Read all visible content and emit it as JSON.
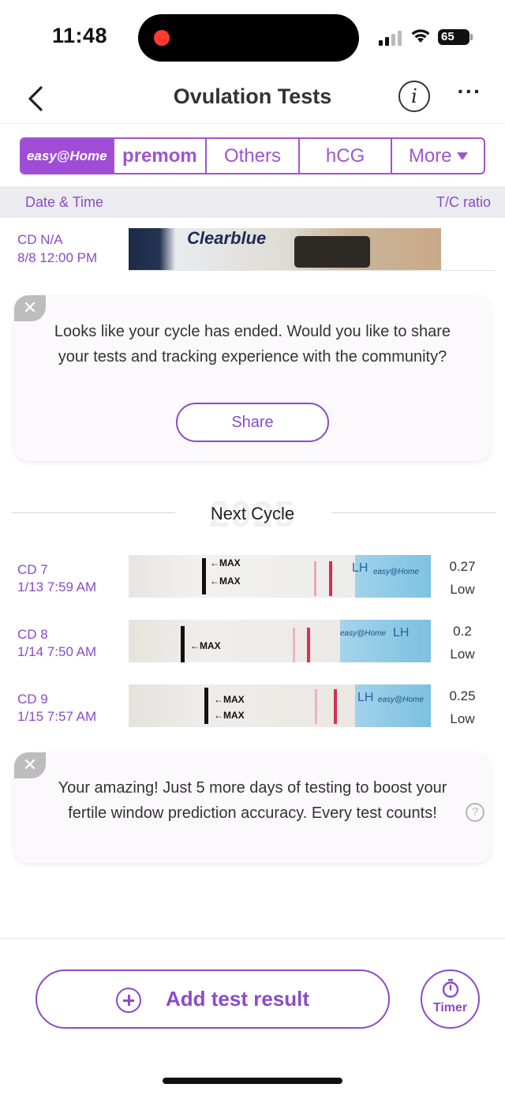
{
  "status_bar": {
    "time": "11:48",
    "battery": "65"
  },
  "nav": {
    "title": "Ovulation Tests"
  },
  "tabs": [
    {
      "label": "easy@Home"
    },
    {
      "label": "premom"
    },
    {
      "label": "Others"
    },
    {
      "label": "hCG"
    },
    {
      "label": "More"
    }
  ],
  "columns": {
    "left": "Date & Time",
    "right": "T/C ratio"
  },
  "previous_cycle_row": {
    "cd": "CD N/A",
    "datetime": "8/8 12:00 PM",
    "strip_brand": "Clearblue"
  },
  "share_card": {
    "text": "Looks like your cycle has ended. Would you like to share your tests and tracking experience with the community?",
    "button": "Share"
  },
  "divider": {
    "watermark": "2025",
    "label": "Next Cycle"
  },
  "tests": [
    {
      "cd": "CD 7",
      "datetime": "1/13 7:59 AM",
      "ratio": "0.27",
      "level": "Low"
    },
    {
      "cd": "CD 8",
      "datetime": "1/14 7:50 AM",
      "ratio": "0.2",
      "level": "Low"
    },
    {
      "cd": "CD 9",
      "datetime": "1/15 7:57 AM",
      "ratio": "0.25",
      "level": "Low"
    }
  ],
  "strip_text": {
    "max": "←MAX",
    "lh": "LH",
    "brand": "easy@Home"
  },
  "tip_card": {
    "text": "Your amazing! Just 5 more days of testing to boost your fertile window prediction accuracy. Every test counts!"
  },
  "bottom": {
    "add_label": "Add test result",
    "timer_label": "Timer"
  }
}
